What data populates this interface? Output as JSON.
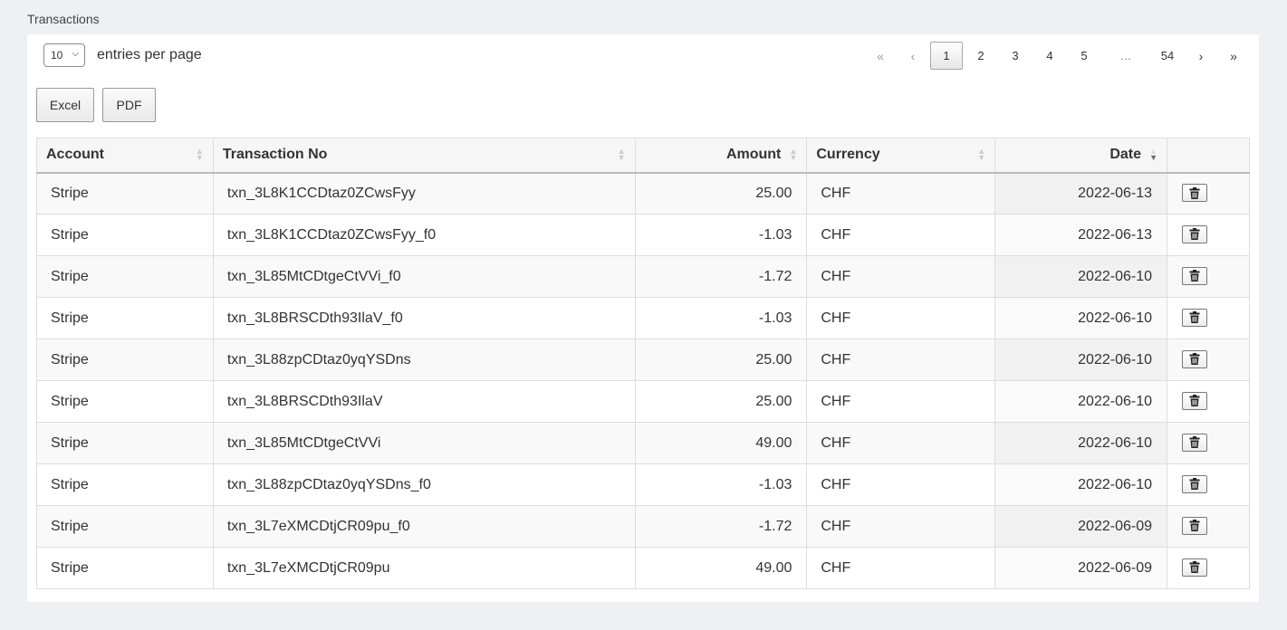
{
  "section_title": "Transactions",
  "per_page": {
    "value": "10",
    "label": "entries per page"
  },
  "pagination": {
    "first": "«",
    "prev": "‹",
    "pages": [
      "1",
      "2",
      "3",
      "4",
      "5"
    ],
    "ellipsis": "…",
    "last_page": "54",
    "next": "›",
    "last": "»",
    "current": "1"
  },
  "export": {
    "excel": "Excel",
    "pdf": "PDF"
  },
  "columns": [
    "Account",
    "Transaction No",
    "Amount",
    "Currency",
    "Date"
  ],
  "sort": {
    "column": "Date",
    "direction": "desc"
  },
  "rows": [
    {
      "account": "Stripe",
      "txn": "txn_3L8K1CCDtaz0ZCwsFyy",
      "amount": "25.00",
      "currency": "CHF",
      "date": "2022-06-13"
    },
    {
      "account": "Stripe",
      "txn": "txn_3L8K1CCDtaz0ZCwsFyy_f0",
      "amount": "-1.03",
      "currency": "CHF",
      "date": "2022-06-13"
    },
    {
      "account": "Stripe",
      "txn": "txn_3L85MtCDtgeCtVVi_f0",
      "amount": "-1.72",
      "currency": "CHF",
      "date": "2022-06-10"
    },
    {
      "account": "Stripe",
      "txn": "txn_3L8BRSCDth93IlaV_f0",
      "amount": "-1.03",
      "currency": "CHF",
      "date": "2022-06-10"
    },
    {
      "account": "Stripe",
      "txn": "txn_3L88zpCDtaz0yqYSDns",
      "amount": "25.00",
      "currency": "CHF",
      "date": "2022-06-10"
    },
    {
      "account": "Stripe",
      "txn": "txn_3L8BRSCDth93IlaV",
      "amount": "25.00",
      "currency": "CHF",
      "date": "2022-06-10"
    },
    {
      "account": "Stripe",
      "txn": "txn_3L85MtCDtgeCtVVi",
      "amount": "49.00",
      "currency": "CHF",
      "date": "2022-06-10"
    },
    {
      "account": "Stripe",
      "txn": "txn_3L88zpCDtaz0yqYSDns_f0",
      "amount": "-1.03",
      "currency": "CHF",
      "date": "2022-06-10"
    },
    {
      "account": "Stripe",
      "txn": "txn_3L7eXMCDtjCR09pu_f0",
      "amount": "-1.72",
      "currency": "CHF",
      "date": "2022-06-09"
    },
    {
      "account": "Stripe",
      "txn": "txn_3L7eXMCDtjCR09pu",
      "amount": "49.00",
      "currency": "CHF",
      "date": "2022-06-09"
    }
  ],
  "row_action_icon": "trash-icon"
}
